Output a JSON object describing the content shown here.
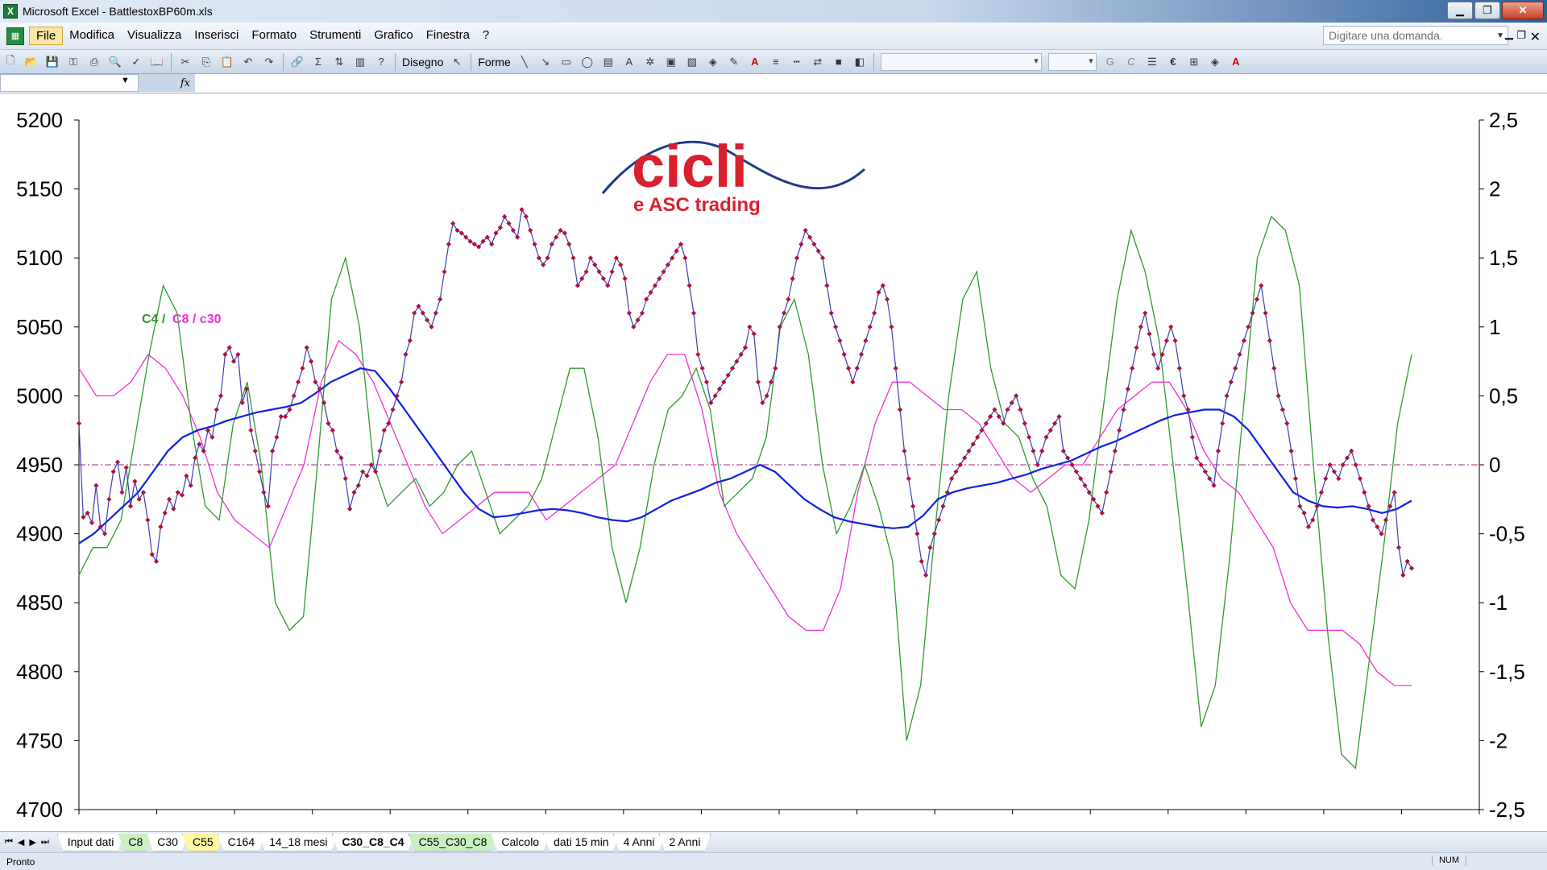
{
  "window": {
    "title": "Microsoft Excel - BattlestoxBP60m.xls",
    "icon": "excel-icon"
  },
  "menubar": {
    "items": [
      "File",
      "Modifica",
      "Visualizza",
      "Inserisci",
      "Formato",
      "Strumenti",
      "Grafico",
      "Finestra",
      "?"
    ],
    "question_placeholder": "Digitare una domanda."
  },
  "toolbar": {
    "draw_label": "Disegno",
    "shapes_label": "Forme"
  },
  "chart": {
    "legend_text_green": "C4 /",
    "legend_text_magenta": "C8 / c30",
    "logo_title": "cicli",
    "logo_subtitle": "e ASC trading"
  },
  "chart_data": {
    "type": "line",
    "left_axis": {
      "ylim": [
        4700,
        5200
      ],
      "ticks": [
        "4700",
        "4750",
        "4800",
        "4850",
        "4900",
        "4950",
        "5000",
        "5050",
        "5100",
        "5150",
        "5200"
      ]
    },
    "right_axis": {
      "ylim": [
        -2.5,
        2.5
      ],
      "ticks": [
        "-2,5",
        "-2",
        "-1,5",
        "-1",
        "-0,5",
        "0",
        "0,5",
        "1",
        "1,5",
        "2",
        "2,5"
      ]
    },
    "reference_line": {
      "axis": "right",
      "value": 0,
      "color": "#aa2288"
    },
    "colors": {
      "price": "#3b3fb0",
      "price_points": "#b0103a",
      "c30": "#0a22e0",
      "c4": "#2e9a2e",
      "c8": "#f030d8"
    },
    "series": [
      {
        "axis": "left",
        "color": "#3b3fb0",
        "markers": true,
        "values": [
          4980,
          4912,
          4915,
          4908,
          4935,
          4905,
          4900,
          4925,
          4945,
          4952,
          4930,
          4948,
          4920,
          4938,
          4925,
          4930,
          4910,
          4885,
          4880,
          4905,
          4915,
          4925,
          4918,
          4930,
          4928,
          4942,
          4935,
          4955,
          4965,
          4960,
          4975,
          4970,
          4990,
          5000,
          5030,
          5035,
          5025,
          5030,
          4995,
          5005,
          4975,
          4960,
          4945,
          4930,
          4920,
          4960,
          4970,
          4985,
          4985,
          4990,
          5000,
          5010,
          5020,
          5035,
          5025,
          5010,
          5005,
          4995,
          4980,
          4975,
          4960,
          4955,
          4940,
          4918,
          4930,
          4935,
          4945,
          4942,
          4950,
          4945,
          4960,
          4975,
          4980,
          4990,
          5000,
          5010,
          5030,
          5040,
          5060,
          5065,
          5060,
          5055,
          5050,
          5060,
          5070,
          5090,
          5110,
          5125,
          5120,
          5118,
          5115,
          5112,
          5110,
          5108,
          5112,
          5115,
          5110,
          5118,
          5122,
          5130,
          5125,
          5120,
          5115,
          5135,
          5130,
          5120,
          5110,
          5100,
          5095,
          5100,
          5110,
          5115,
          5120,
          5118,
          5110,
          5100,
          5080,
          5085,
          5090,
          5100,
          5095,
          5090,
          5085,
          5080,
          5090,
          5100,
          5095,
          5085,
          5060,
          5050,
          5055,
          5060,
          5070,
          5075,
          5080,
          5085,
          5090,
          5095,
          5100,
          5105,
          5110,
          5100,
          5080,
          5060,
          5030,
          5020,
          5010,
          4995,
          5000,
          5005,
          5010,
          5015,
          5020,
          5025,
          5030,
          5035,
          5050,
          5045,
          5010,
          4995,
          5000,
          5010,
          5020,
          5050,
          5060,
          5070,
          5085,
          5100,
          5110,
          5120,
          5115,
          5110,
          5105,
          5100,
          5080,
          5060,
          5050,
          5040,
          5030,
          5020,
          5010,
          5020,
          5030,
          5040,
          5050,
          5060,
          5075,
          5080,
          5070,
          5050,
          5020,
          4990,
          4960,
          4940,
          4920,
          4900,
          4880,
          4870,
          4890,
          4900,
          4910,
          4920,
          4930,
          4940,
          4945,
          4950,
          4955,
          4960,
          4965,
          4970,
          4975,
          4980,
          4985,
          4990,
          4985,
          4980,
          4990,
          4995,
          5000,
          4990,
          4980,
          4970,
          4960,
          4950,
          4960,
          4970,
          4975,
          4980,
          4985,
          4960,
          4955,
          4950,
          4945,
          4940,
          4935,
          4930,
          4925,
          4920,
          4915,
          4930,
          4945,
          4960,
          4975,
          4990,
          5005,
          5020,
          5035,
          5050,
          5060,
          5045,
          5030,
          5020,
          5030,
          5040,
          5050,
          5040,
          5020,
          5000,
          4990,
          4970,
          4955,
          4950,
          4945,
          4940,
          4935,
          4960,
          4980,
          5000,
          5010,
          5020,
          5030,
          5040,
          5050,
          5060,
          5070,
          5080,
          5060,
          5040,
          5020,
          5000,
          4990,
          4980,
          4960,
          4940,
          4920,
          4915,
          4905,
          4910,
          4920,
          4930,
          4940,
          4950,
          4945,
          4940,
          4950,
          4955,
          4960,
          4950,
          4940,
          4930,
          4920,
          4910,
          4905,
          4900,
          4910,
          4920,
          4930,
          4890,
          4870,
          4880,
          4875
        ]
      },
      {
        "axis": "left",
        "color": "#0a22e0",
        "values": [
          4893,
          4900,
          4910,
          4920,
          4930,
          4945,
          4960,
          4970,
          4975,
          4978,
          4982,
          4985,
          4988,
          4990,
          4992,
          4995,
          5002,
          5010,
          5015,
          5020,
          5018,
          5005,
          4990,
          4975,
          4960,
          4945,
          4930,
          4918,
          4912,
          4913,
          4915,
          4917,
          4918,
          4917,
          4915,
          4912,
          4910,
          4909,
          4912,
          4918,
          4924,
          4928,
          4932,
          4937,
          4940,
          4945,
          4950,
          4945,
          4935,
          4925,
          4918,
          4912,
          4909,
          4907,
          4905,
          4904,
          4905,
          4913,
          4925,
          4930,
          4933,
          4935,
          4937,
          4940,
          4943,
          4947,
          4950,
          4953,
          4958,
          4963,
          4967,
          4972,
          4977,
          4982,
          4986,
          4988,
          4990,
          4990,
          4985,
          4975,
          4960,
          4945,
          4930,
          4924,
          4920,
          4919,
          4920,
          4918,
          4915,
          4918,
          4924
        ]
      },
      {
        "axis": "right",
        "color": "#f030d8",
        "values": [
          0.7,
          0.5,
          0.5,
          0.6,
          0.8,
          0.7,
          0.5,
          0.2,
          -0.2,
          -0.4,
          -0.5,
          -0.6,
          -0.3,
          0.0,
          0.6,
          0.9,
          0.8,
          0.6,
          0.3,
          0.0,
          -0.3,
          -0.5,
          -0.4,
          -0.3,
          -0.2,
          -0.2,
          -0.2,
          -0.4,
          -0.3,
          -0.2,
          -0.1,
          0.0,
          0.3,
          0.6,
          0.8,
          0.8,
          0.4,
          -0.2,
          -0.5,
          -0.7,
          -0.9,
          -1.1,
          -1.2,
          -1.2,
          -0.9,
          -0.2,
          0.3,
          0.6,
          0.6,
          0.5,
          0.4,
          0.4,
          0.3,
          0.1,
          -0.1,
          -0.2,
          -0.1,
          0.0,
          0.0,
          0.2,
          0.4,
          0.5,
          0.6,
          0.6,
          0.4,
          0.1,
          -0.1,
          -0.2,
          -0.4,
          -0.6,
          -1.0,
          -1.2,
          -1.2,
          -1.2,
          -1.3,
          -1.5,
          -1.6,
          -1.6
        ]
      },
      {
        "axis": "right",
        "color": "#2e9a2e",
        "values": [
          -0.8,
          -0.6,
          -0.6,
          -0.4,
          0.2,
          0.8,
          1.3,
          1.1,
          0.3,
          -0.3,
          -0.4,
          0.3,
          0.6,
          0.0,
          -1.0,
          -1.2,
          -1.1,
          0.0,
          1.2,
          1.5,
          1.0,
          0.0,
          -0.3,
          -0.2,
          -0.1,
          -0.3,
          -0.2,
          0.0,
          0.1,
          -0.2,
          -0.5,
          -0.4,
          -0.3,
          -0.1,
          0.3,
          0.7,
          0.7,
          0.2,
          -0.6,
          -1.0,
          -0.6,
          0.0,
          0.4,
          0.5,
          0.7,
          0.4,
          -0.3,
          -0.2,
          -0.1,
          0.2,
          1.0,
          1.2,
          0.8,
          0.0,
          -0.5,
          -0.3,
          0.0,
          -0.3,
          -0.7,
          -2.0,
          -1.6,
          -0.5,
          0.5,
          1.2,
          1.4,
          0.7,
          0.3,
          0.2,
          -0.1,
          -0.3,
          -0.8,
          -0.9,
          -0.4,
          0.4,
          1.2,
          1.7,
          1.4,
          0.9,
          0.0,
          -0.9,
          -1.9,
          -1.6,
          -0.7,
          0.4,
          1.5,
          1.8,
          1.7,
          1.3,
          0.0,
          -1.2,
          -2.1,
          -2.2,
          -1.4,
          -0.6,
          0.3,
          0.8
        ]
      }
    ]
  },
  "sheet_tabs": [
    {
      "label": "Input dati",
      "style": "white"
    },
    {
      "label": "C8",
      "style": "green"
    },
    {
      "label": "C30",
      "style": "white"
    },
    {
      "label": "C55",
      "style": "yellow"
    },
    {
      "label": "C164",
      "style": "white"
    },
    {
      "label": "14_18 mesi",
      "style": "white"
    },
    {
      "label": "C30_C8_C4",
      "style": "active"
    },
    {
      "label": "C55_C30_C8",
      "style": "green"
    },
    {
      "label": "Calcolo",
      "style": "white"
    },
    {
      "label": "dati 15 min",
      "style": "white"
    },
    {
      "label": "4 Anni",
      "style": "white"
    },
    {
      "label": "2 Anni",
      "style": "white"
    }
  ],
  "status": {
    "text": "Pronto",
    "num": "NUM"
  }
}
